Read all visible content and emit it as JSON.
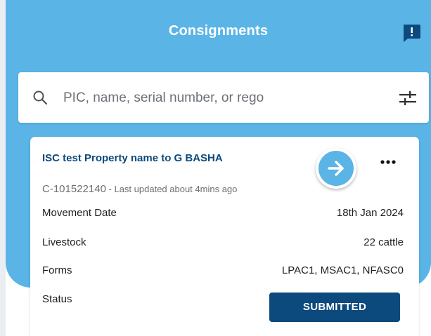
{
  "header": {
    "title": "Consignments",
    "feedback_icon": "feedback-icon"
  },
  "search": {
    "placeholder": "PIC, name, serial number, or rego",
    "value": "",
    "search_icon": "search-icon",
    "filter_icon": "filter-icon"
  },
  "card": {
    "title": "ISC test Property name to G BASHA",
    "id": "C-101522140",
    "updated": " - Last updated about 4mins ago",
    "rows": [
      {
        "label": "Movement Date",
        "value": "18th Jan 2024"
      },
      {
        "label": "Livestock",
        "value": "22 cattle"
      },
      {
        "label": "Forms",
        "value": "LPAC1, MSAC1, NFASC0"
      },
      {
        "label": "Status",
        "value": ""
      }
    ],
    "status_label": "SUBMITTED"
  },
  "colors": {
    "header_blue": "#5ab4e6",
    "navy": "#0c4a7d",
    "title_navy": "#0d4a7b"
  }
}
